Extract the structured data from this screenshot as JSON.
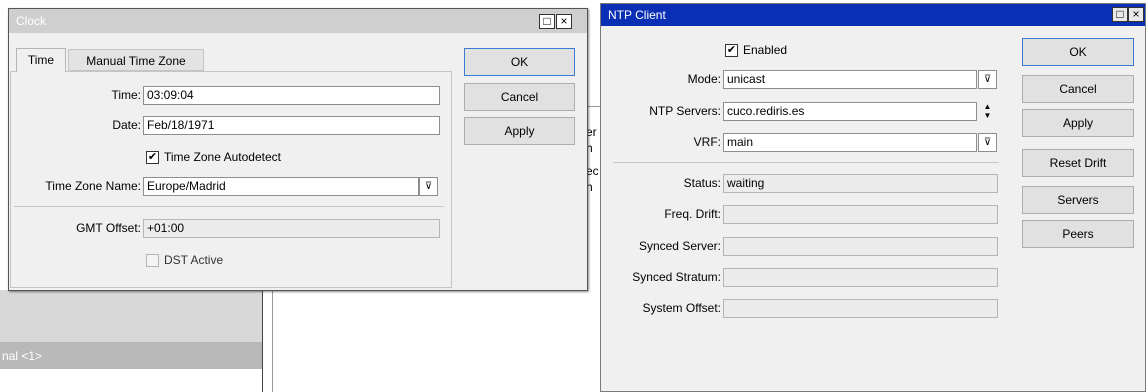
{
  "background": {
    "fragment_text": [
      "er",
      "h",
      "ec",
      "h"
    ],
    "terminal_tab": "nal <1>"
  },
  "clock": {
    "title": "Clock",
    "title_buttons": {
      "maximize": "□",
      "close": "×"
    },
    "tabs": [
      "Time",
      "Manual Time Zone"
    ],
    "active_tab": "Time",
    "fields": {
      "time": {
        "label": "Time:",
        "value": "03:09:04"
      },
      "date": {
        "label": "Date:",
        "value": "Feb/18/1971"
      },
      "tz_autodetect": {
        "label": "Time Zone Autodetect",
        "checked": true
      },
      "tz_name": {
        "label": "Time Zone Name:",
        "value": "Europe/Madrid"
      },
      "gmt_offset": {
        "label": "GMT Offset:",
        "value": "+01:00"
      },
      "dst_active": {
        "label": "DST Active",
        "checked": false
      }
    },
    "buttons": {
      "ok": "OK",
      "cancel": "Cancel",
      "apply": "Apply"
    }
  },
  "ntp": {
    "title": "NTP Client",
    "title_buttons": {
      "maximize": "□",
      "close": "×"
    },
    "enabled": {
      "label": "Enabled",
      "checked": true
    },
    "fields": {
      "mode": {
        "label": "Mode:",
        "value": "unicast"
      },
      "servers": {
        "label": "NTP Servers:",
        "value": "cuco.rediris.es"
      },
      "vrf": {
        "label": "VRF:",
        "value": "main"
      },
      "status": {
        "label": "Status:",
        "value": "waiting"
      },
      "freq_drift": {
        "label": "Freq. Drift:",
        "value": ""
      },
      "synced_server": {
        "label": "Synced Server:",
        "value": ""
      },
      "synced_stratum": {
        "label": "Synced Stratum:",
        "value": ""
      },
      "system_offset": {
        "label": "System Offset:",
        "value": ""
      }
    },
    "buttons": {
      "ok": "OK",
      "cancel": "Cancel",
      "apply": "Apply",
      "reset_drift": "Reset Drift",
      "servers": "Servers",
      "peers": "Peers"
    }
  },
  "icons": {
    "checkmark": "✔",
    "dropdown": "⊽",
    "spinner_up": "▲",
    "spinner_down": "▼"
  }
}
